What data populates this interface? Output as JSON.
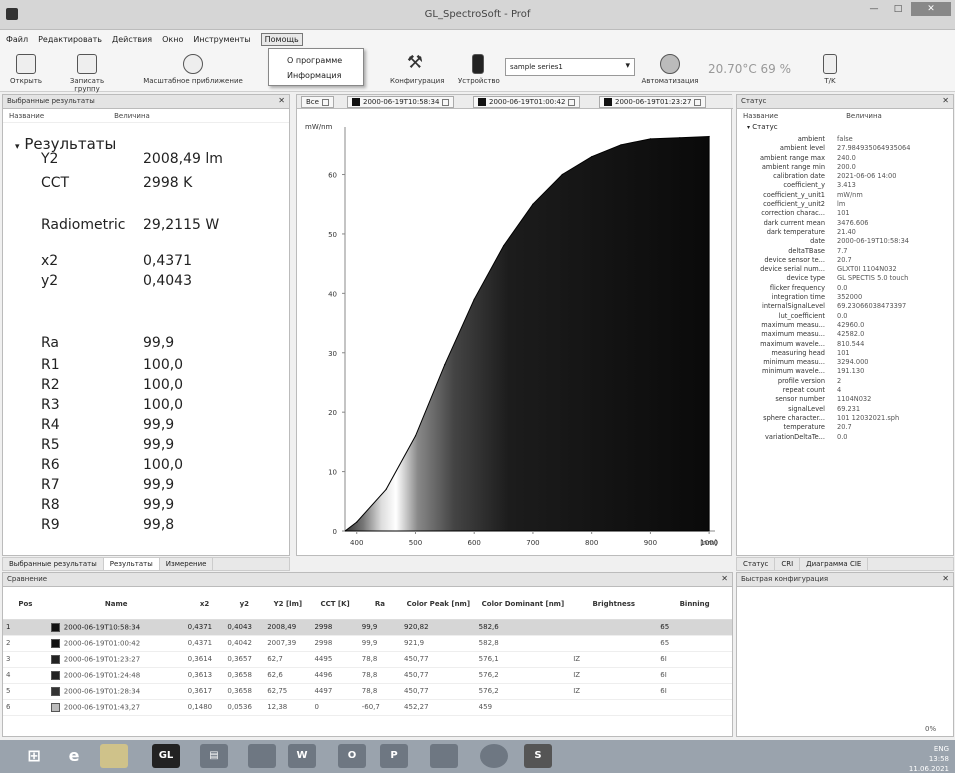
{
  "window": {
    "title": "GL_SpectroSoft - Prof"
  },
  "menu": {
    "items": [
      "Файл",
      "Редактировать",
      "Действия",
      "Окно",
      "Инструменты",
      "Помощь"
    ]
  },
  "help_menu": {
    "items": [
      "О программе",
      "Информация"
    ]
  },
  "toolbar": {
    "open": "Открыть",
    "save_group": "Записать группу",
    "scale": "Масштабное приближение",
    "cut_text": "Конфигурация",
    "devices": "Устройство",
    "series": "sample series1",
    "auto": "Автоматизация",
    "hidden_text": "Измерение",
    "temp_text": "20.70°C  69 %",
    "tm": "T/K"
  },
  "left_panel": {
    "title": "Выбранные результаты",
    "col_name": "Название",
    "col_value": "Величина",
    "root": "Результаты",
    "items": [
      {
        "k": "Y2",
        "v": "2008,49 lm"
      },
      {
        "k": "CCT",
        "v": "2998 K"
      },
      {
        "k": "Radiometric",
        "v": "29,2115 W"
      },
      {
        "k": "x2",
        "v": "0,4371"
      },
      {
        "k": "y2",
        "v": "0,4043"
      },
      {
        "k": "Ra",
        "v": "99,9"
      },
      {
        "k": "R1",
        "v": "100,0"
      },
      {
        "k": "R2",
        "v": "100,0"
      },
      {
        "k": "R3",
        "v": "100,0"
      },
      {
        "k": "R4",
        "v": "99,9"
      },
      {
        "k": "R5",
        "v": "99,9"
      },
      {
        "k": "R6",
        "v": "100,0"
      },
      {
        "k": "R7",
        "v": "99,9"
      },
      {
        "k": "R8",
        "v": "99,9"
      },
      {
        "k": "R9",
        "v": "99,8"
      }
    ],
    "tabs": [
      "Выбранные результаты",
      "Результаты",
      "Измерение"
    ]
  },
  "chart_tabs": [
    {
      "label": "Все",
      "color": "#ffffff"
    },
    {
      "label": "2000-06-19T10:58:34",
      "color": "#111111"
    },
    {
      "label": "2000-06-19T01:00:42",
      "color": "#333333"
    },
    {
      "label": "2000-06-19T01:23:27",
      "color": "#222222"
    }
  ],
  "chart_data": {
    "type": "area",
    "ylabel": "mW/nm",
    "xlabel": "[nm]",
    "x": [
      380,
      400,
      450,
      500,
      550,
      600,
      650,
      700,
      750,
      800,
      850,
      900,
      950,
      1000
    ],
    "values": [
      0,
      1.5,
      7,
      16,
      28,
      39,
      48,
      55,
      60,
      63,
      65,
      66,
      66.2,
      66.4
    ],
    "xticks": [
      "400",
      "500",
      "600",
      "700",
      "800",
      "900",
      "1000"
    ],
    "yticks": [
      "0",
      "10",
      "20",
      "30",
      "40",
      "50",
      "60"
    ],
    "xlim": [
      380,
      1010
    ],
    "ylim": [
      0,
      68
    ],
    "grid": false
  },
  "status_panel": {
    "title": "Статус",
    "col_name": "Название",
    "col_value": "Величина",
    "root": "Статус",
    "rows": [
      {
        "k": "ambient",
        "v": "false"
      },
      {
        "k": "ambient level",
        "v": "27.984935064935064"
      },
      {
        "k": "ambient range max",
        "v": "240.0"
      },
      {
        "k": "ambient range min",
        "v": "200.0"
      },
      {
        "k": "calibration date",
        "v": "2021-06-06 14:00"
      },
      {
        "k": "coefficient_y",
        "v": "3.413"
      },
      {
        "k": "coefficient_y_unit1",
        "v": "mW/nm"
      },
      {
        "k": "coefficient_y_unit2",
        "v": "lm"
      },
      {
        "k": "correction charac...",
        "v": "101"
      },
      {
        "k": "dark current mean",
        "v": "3476.606"
      },
      {
        "k": "dark temperature",
        "v": "21.40"
      },
      {
        "k": "date",
        "v": "2000-06-19T10:58:34"
      },
      {
        "k": "deltaTBase",
        "v": "7.7"
      },
      {
        "k": "device sensor te...",
        "v": "20.7"
      },
      {
        "k": "device serial num...",
        "v": "GLXT0I 1104N032"
      },
      {
        "k": "device type",
        "v": "GL SPECTIS 5.0 touch"
      },
      {
        "k": "flicker frequency",
        "v": "0.0"
      },
      {
        "k": "integration time",
        "v": "352000"
      },
      {
        "k": "internalSignalLevel",
        "v": "69.23066038473397"
      },
      {
        "k": "lut_coefficient",
        "v": "0.0"
      },
      {
        "k": "maximum measu...",
        "v": "42960.0"
      },
      {
        "k": "maximum measu...",
        "v": "42582.0"
      },
      {
        "k": "maximum wavele...",
        "v": "810.544"
      },
      {
        "k": "measuring head",
        "v": "101"
      },
      {
        "k": "minimum measu...",
        "v": "3294.000"
      },
      {
        "k": "minimum wavele...",
        "v": "191.130"
      },
      {
        "k": "profile version",
        "v": "2"
      },
      {
        "k": "repeat count",
        "v": "4"
      },
      {
        "k": "sensor number",
        "v": "1104N032"
      },
      {
        "k": "signalLevel",
        "v": "69.231"
      },
      {
        "k": "sphere character...",
        "v": "101 12032021.sph"
      },
      {
        "k": "temperature",
        "v": "20.7"
      },
      {
        "k": "variationDeltaTe...",
        "v": "0.0"
      }
    ],
    "tabs": [
      "Статус",
      "CRI",
      "Диаграмма CIE"
    ]
  },
  "compare": {
    "title": "Сравнение",
    "headers": [
      "Pos",
      "Name",
      "x2",
      "y2",
      "Y2 [lm]",
      "CCT [K]",
      "Ra",
      "Color Peak [nm]",
      "Color Dominant [nm]",
      "Brightness",
      "Binning"
    ],
    "rows": [
      {
        "pos": "1",
        "color": "#111111",
        "name": "2000-06-19T10:58:34",
        "x2": "0,4371",
        "y2": "0,4043",
        "Y2": "2008,49",
        "CCT": "2998",
        "Ra": "99,9",
        "peak": "920,82",
        "dom": "582,6",
        "bright": "",
        "bin": "65"
      },
      {
        "pos": "2",
        "color": "#111111",
        "name": "2000-06-19T01:00:42",
        "x2": "0,4371",
        "y2": "0,4042",
        "Y2": "2007,39",
        "CCT": "2998",
        "Ra": "99,9",
        "peak": "921,9",
        "dom": "582,8",
        "bright": "",
        "bin": "65"
      },
      {
        "pos": "3",
        "color": "#222222",
        "name": "2000-06-19T01:23:27",
        "x2": "0,3614",
        "y2": "0,3657",
        "Y2": "62,7",
        "CCT": "4495",
        "Ra": "78,8",
        "peak": "450,77",
        "dom": "576,1",
        "bright": "IZ",
        "bin": "6I"
      },
      {
        "pos": "4",
        "color": "#222222",
        "name": "2000-06-19T01:24:48",
        "x2": "0,3613",
        "y2": "0,3658",
        "Y2": "62,6",
        "CCT": "4496",
        "Ra": "78,8",
        "peak": "450,77",
        "dom": "576,2",
        "bright": "IZ",
        "bin": "6I"
      },
      {
        "pos": "5",
        "color": "#333333",
        "name": "2000-06-19T01:28:34",
        "x2": "0,3617",
        "y2": "0,3658",
        "Y2": "62,75",
        "CCT": "4497",
        "Ra": "78,8",
        "peak": "450,77",
        "dom": "576,2",
        "bright": "IZ",
        "bin": "6I"
      },
      {
        "pos": "6",
        "color": "#bbbbbb",
        "name": "2000-06-19T01:43,27",
        "x2": "0,1480",
        "y2": "0,0536",
        "Y2": "12,38",
        "CCT": "0",
        "Ra": "-60,7",
        "peak": "452,27",
        "dom": "459",
        "bright": "",
        "bin": ""
      }
    ]
  },
  "quick_panel": {
    "title": "Быстрая конфигурация"
  },
  "zoom": "0%",
  "clock": {
    "time": "13:58",
    "date": "11.06.2021",
    "lang": "ENG"
  },
  "taskbar": [
    "GL",
    "W",
    "O",
    "P",
    "S"
  ]
}
